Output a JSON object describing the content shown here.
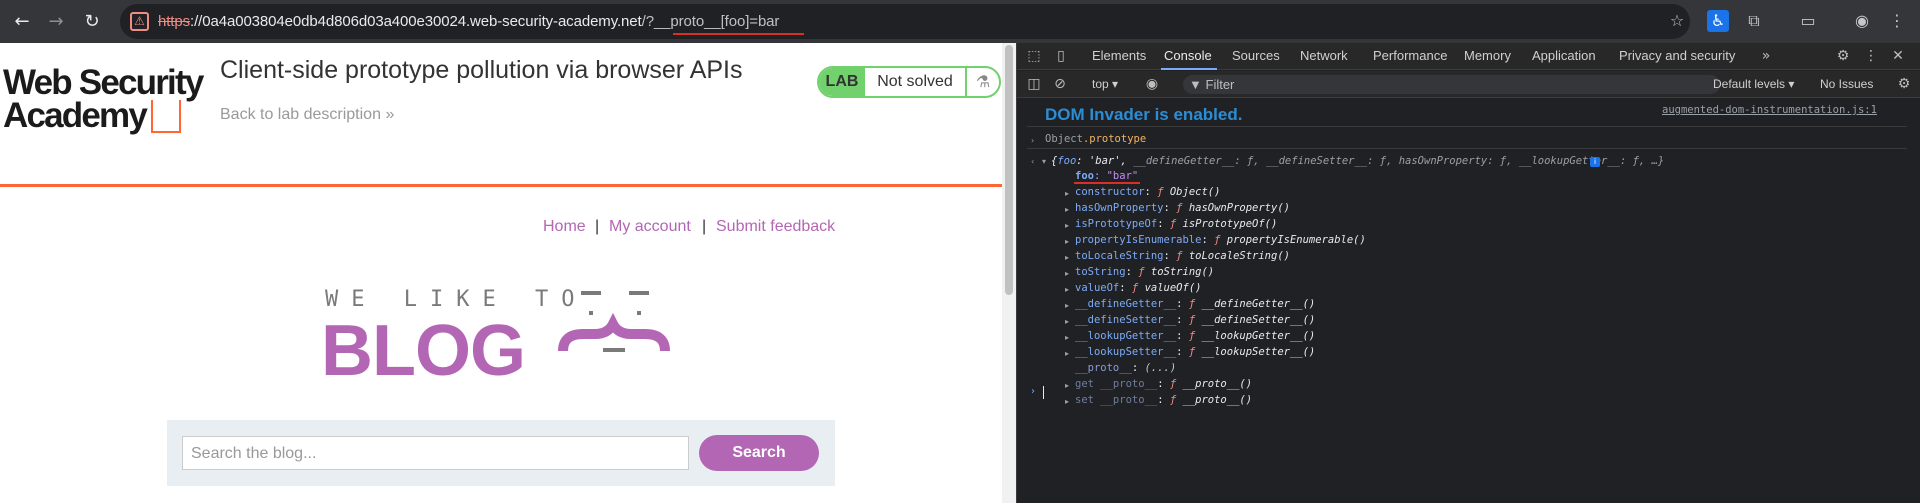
{
  "browser": {
    "url_scheme": "https",
    "url_host": "://0a4a003804e0db4d806d03a400e30024.web-security-academy.net",
    "url_path": "/?__proto__[foo]=bar"
  },
  "page": {
    "logo_line1": "Web Security",
    "logo_line2": "Academy",
    "lab_title": "Client-side prototype pollution via browser APIs",
    "back_link": "Back to lab description",
    "back_chevron": "»",
    "badge_lab": "LAB",
    "badge_status": "Not solved",
    "nav": {
      "home": "Home",
      "sep": "|",
      "account": "My account",
      "feedback": "Submit feedback"
    },
    "hero_small": "WE LIKE TO",
    "hero_big": "BLOG",
    "search_placeholder": "Search the blog...",
    "search_button": "Search"
  },
  "devtools": {
    "tabs": [
      "Elements",
      "Console",
      "Sources",
      "Network",
      "Performance",
      "Memory",
      "Application",
      "Privacy and security"
    ],
    "active_tab": "Console",
    "context": "top",
    "filter_placeholder": "Filter",
    "levels": "Default levels",
    "issues": "No Issues",
    "console": {
      "dom_invader": "DOM Invader is enabled.",
      "source_link": "augmented-dom-instrumentation.js:1",
      "input_obj": "Object",
      "input_prop": ".prototype",
      "summary_open": "{",
      "summary_key": "foo",
      "summary_val": ": 'bar', ",
      "summary_rest": "__defineGetter__: ƒ, __defineSetter__: ƒ, hasOwnProperty: ƒ, __lookupGetter__: ƒ, …}",
      "foo_key": "foo",
      "foo_val": ": \"bar\"",
      "props": [
        {
          "key": "constructor",
          "val": "ƒ Object()"
        },
        {
          "key": "hasOwnProperty",
          "val": "ƒ hasOwnProperty()"
        },
        {
          "key": "isPrototypeOf",
          "val": "ƒ isPrototypeOf()"
        },
        {
          "key": "propertyIsEnumerable",
          "val": "ƒ propertyIsEnumerable()"
        },
        {
          "key": "toLocaleString",
          "val": "ƒ toLocaleString()"
        },
        {
          "key": "toString",
          "val": "ƒ toString()"
        },
        {
          "key": "valueOf",
          "val": "ƒ valueOf()"
        },
        {
          "key": "__defineGetter__",
          "val": "ƒ __defineGetter__()"
        },
        {
          "key": "__defineSetter__",
          "val": "ƒ __defineSetter__()"
        },
        {
          "key": "__lookupGetter__",
          "val": "ƒ __lookupGetter__()"
        },
        {
          "key": "__lookupSetter__",
          "val": "ƒ __lookupSetter__()"
        },
        {
          "key": "__proto__",
          "val": "(...)"
        },
        {
          "key": "get __proto__",
          "val": "ƒ __proto__()"
        },
        {
          "key": "set __proto__",
          "val": "ƒ __proto__()"
        }
      ]
    }
  },
  "colors": {
    "accent_purple": "#b366b3",
    "orange": "#ff6633",
    "lab_green": "#70d16d",
    "devtools_bg": "#202124"
  }
}
